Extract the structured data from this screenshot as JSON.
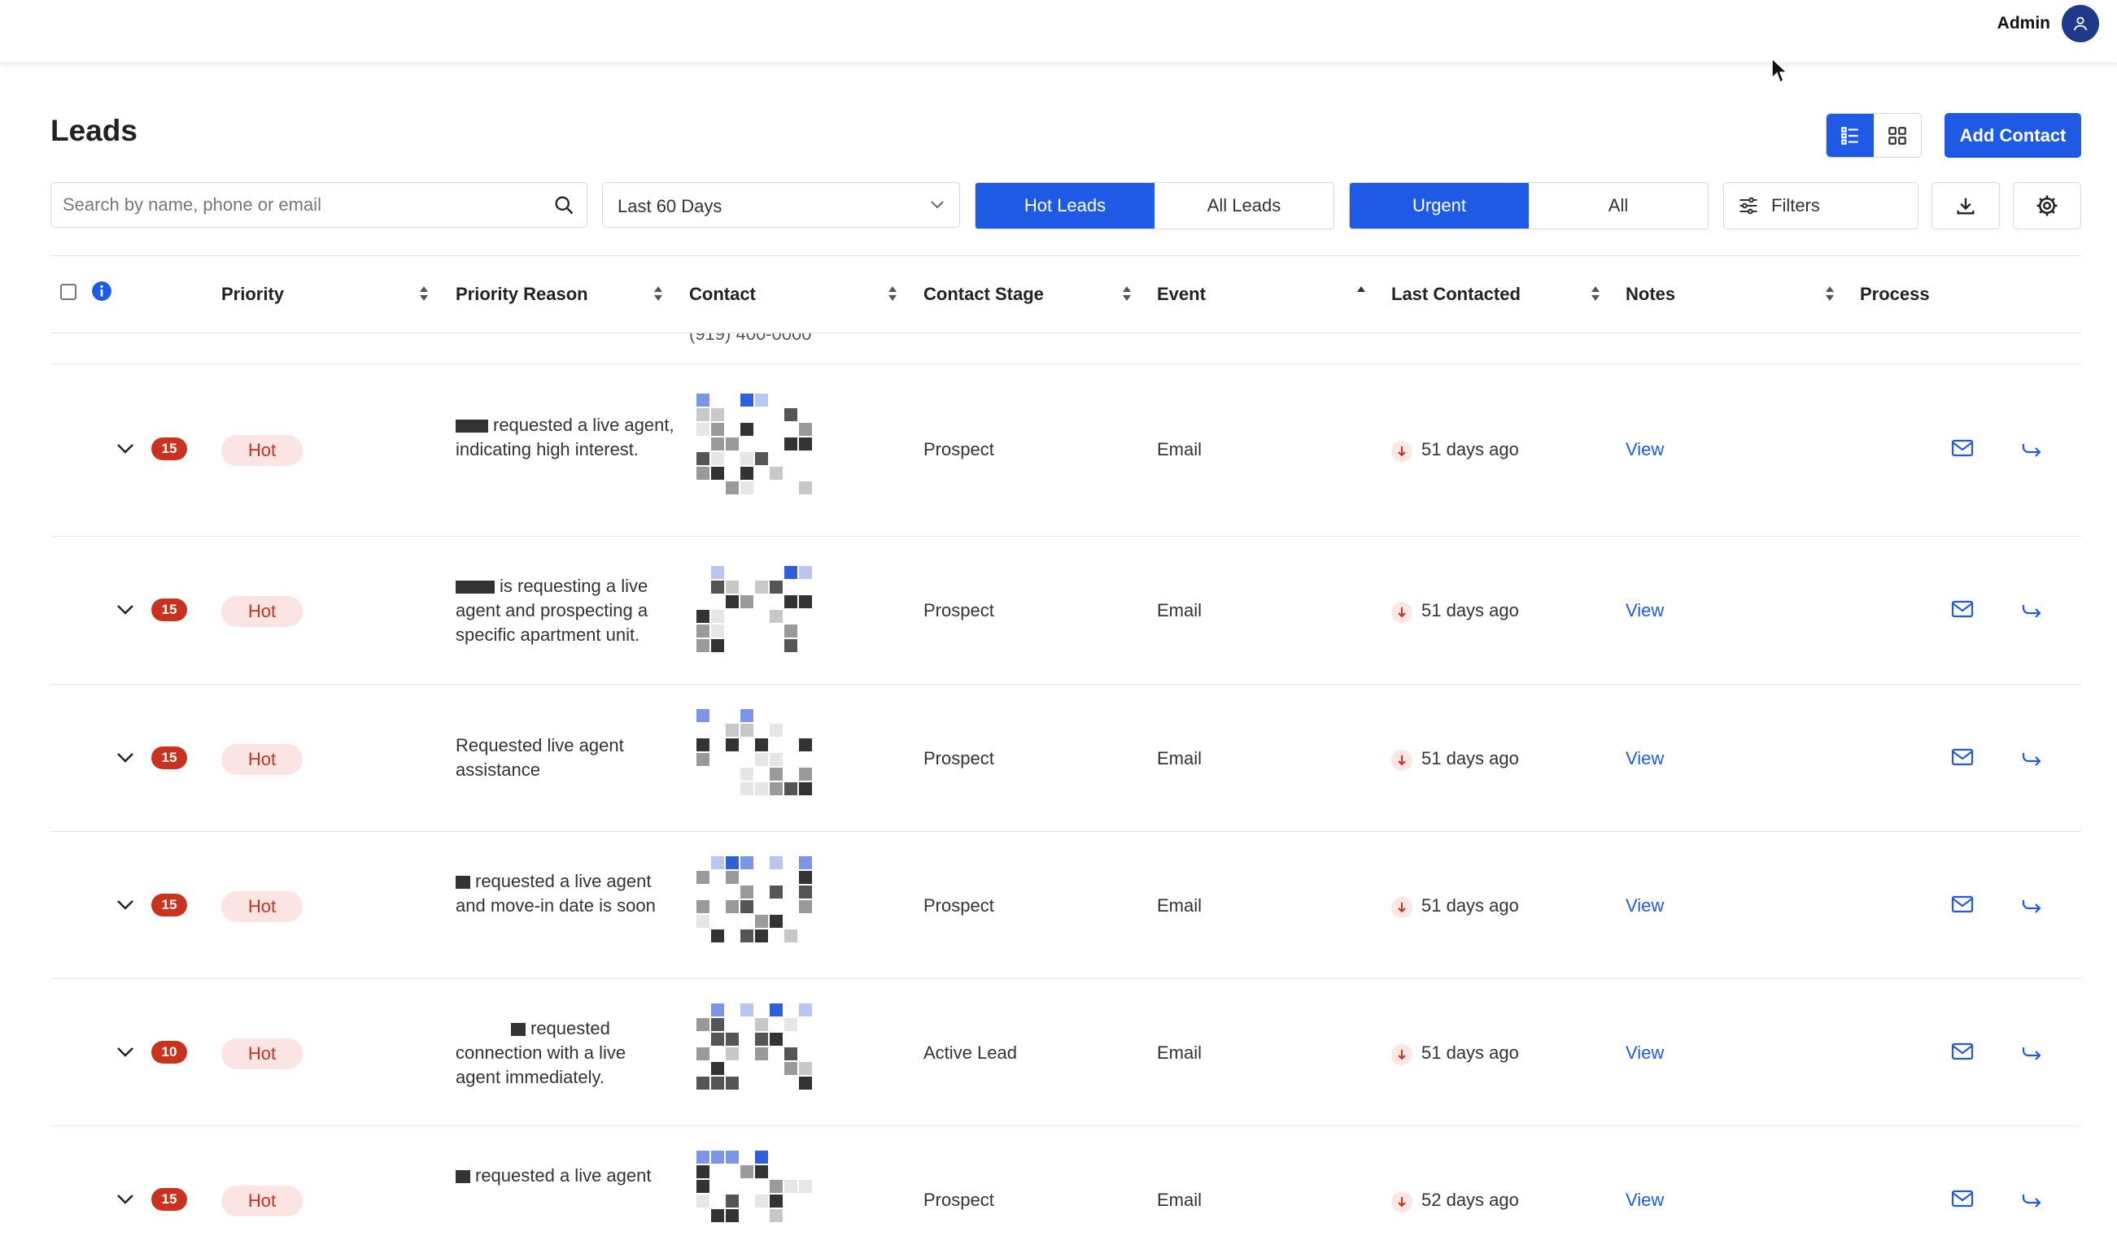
{
  "topbar": {
    "user_label": "Admin"
  },
  "page": {
    "title": "Leads",
    "add_contact_label": "Add Contact"
  },
  "filters": {
    "search_placeholder": "Search by name, phone or email",
    "date_range": "Last 60 Days",
    "lead_type_options": [
      "Hot Leads",
      "All Leads"
    ],
    "lead_type_selected": "Hot Leads",
    "urgency_options": [
      "Urgent",
      "All"
    ],
    "urgency_selected": "Urgent",
    "filters_label": "Filters"
  },
  "table": {
    "columns": [
      "Priority",
      "Priority Reason",
      "Contact",
      "Contact Stage",
      "Event",
      "Last Contacted",
      "Notes",
      "Process"
    ],
    "ghost_peek": "(919) 400-0000",
    "rows": [
      {
        "score": "15",
        "priority": "Hot",
        "reason": "requested a live agent, indicating high interest.",
        "stage": "Prospect",
        "event": "Email",
        "last_contacted": "51 days ago",
        "notes": "View"
      },
      {
        "score": "15",
        "priority": "Hot",
        "reason": "is requesting a live agent and prospecting a specific apartment unit.",
        "stage": "Prospect",
        "event": "Email",
        "last_contacted": "51 days ago",
        "notes": "View"
      },
      {
        "score": "15",
        "priority": "Hot",
        "reason": "Requested live agent assistance",
        "stage": "Prospect",
        "event": "Email",
        "last_contacted": "51 days ago",
        "notes": "View"
      },
      {
        "score": "15",
        "priority": "Hot",
        "reason": "requested a live agent and move-in date is soon",
        "stage": "Prospect",
        "event": "Email",
        "last_contacted": "51 days ago",
        "notes": "View"
      },
      {
        "score": "10",
        "priority": "Hot",
        "reason": "requested connection with a live agent immediately.",
        "stage": "Active Lead",
        "event": "Email",
        "last_contacted": "51 days ago",
        "notes": "View"
      },
      {
        "score": "15",
        "priority": "Hot",
        "reason": "requested a live agent",
        "stage": "Prospect",
        "event": "Email",
        "last_contacted": "52 days ago",
        "notes": "View"
      }
    ]
  },
  "colors": {
    "accent": "#1f5ae6",
    "hot": "#c8321f",
    "hot_bg": "#fbe4e2"
  }
}
